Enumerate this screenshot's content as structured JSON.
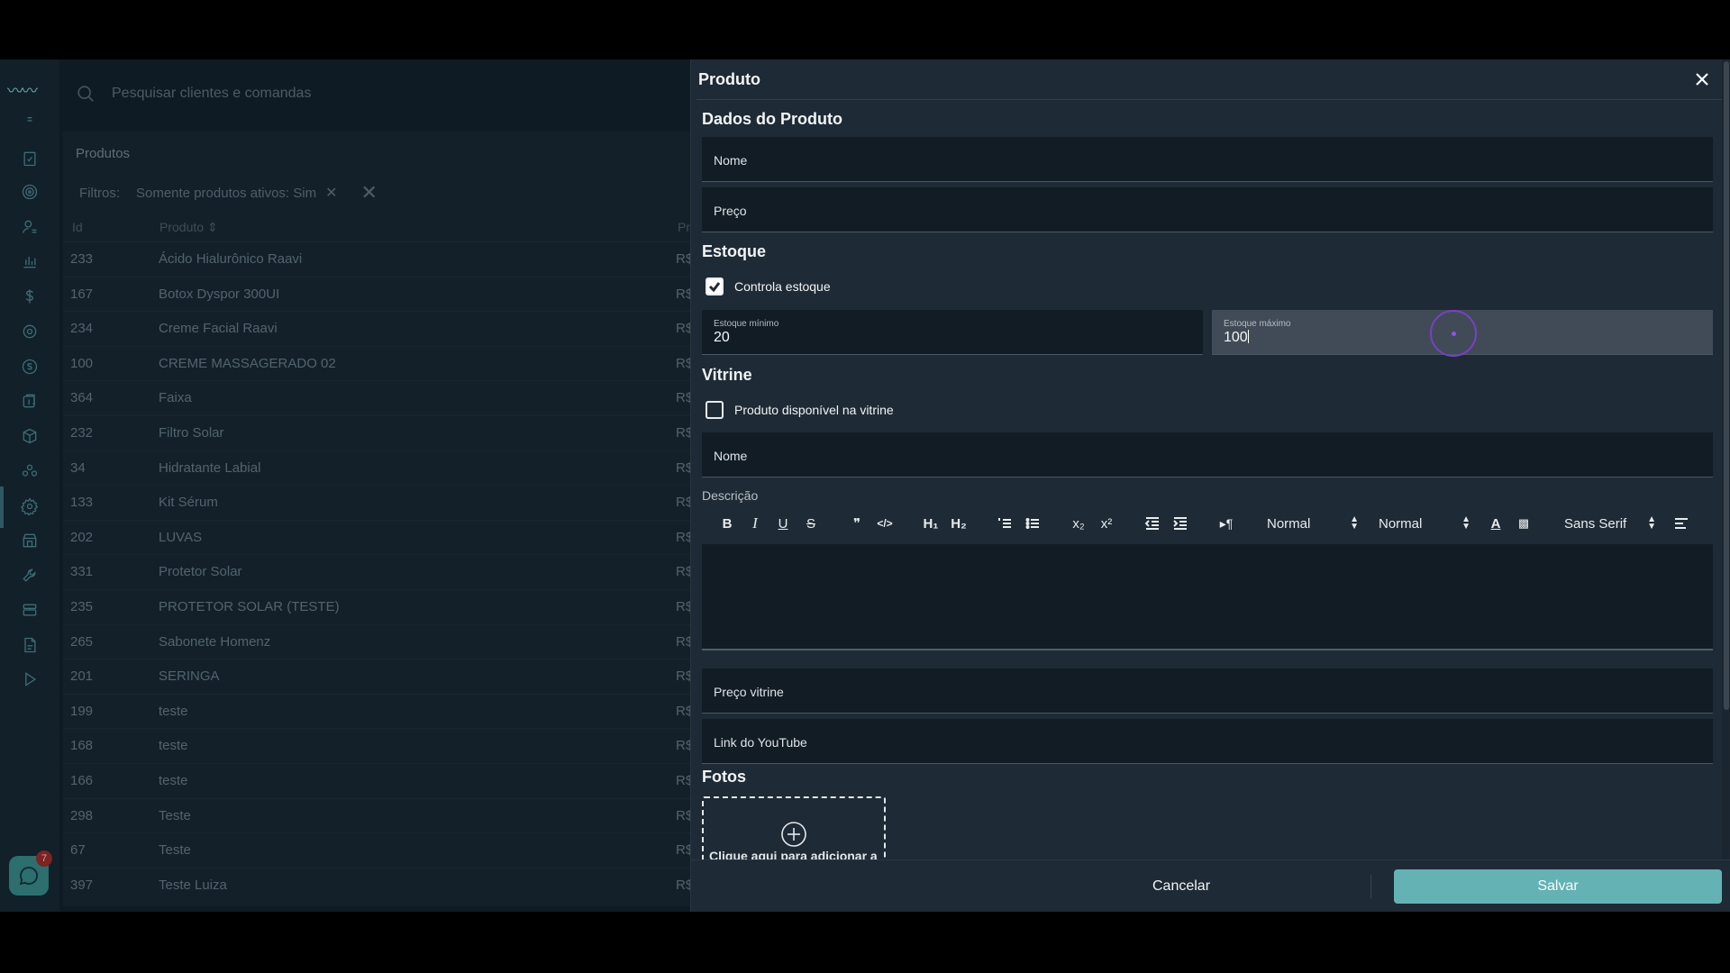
{
  "search": {
    "placeholder": "Pesquisar clientes e comandas"
  },
  "list": {
    "title": "Produtos",
    "filters_label": "Filtros:",
    "filter_chip": "Somente produtos ativos: Sim",
    "columns": {
      "id": "Id",
      "product": "Produto",
      "price": "Pr"
    },
    "currency": "R$",
    "rows": [
      {
        "id": "233",
        "name": "Ácido Hialurônico Raavi"
      },
      {
        "id": "167",
        "name": "Botox Dyspor 300UI"
      },
      {
        "id": "234",
        "name": "Creme Facial Raavi"
      },
      {
        "id": "100",
        "name": "CREME MASSAGERADO 02"
      },
      {
        "id": "364",
        "name": "Faixa"
      },
      {
        "id": "232",
        "name": "Filtro Solar"
      },
      {
        "id": "34",
        "name": "Hidratante Labial"
      },
      {
        "id": "133",
        "name": "Kit Sérum"
      },
      {
        "id": "202",
        "name": "LUVAS"
      },
      {
        "id": "331",
        "name": "Protetor Solar"
      },
      {
        "id": "235",
        "name": "PROTETOR SOLAR (TESTE)"
      },
      {
        "id": "265",
        "name": "Sabonete Homenz"
      },
      {
        "id": "201",
        "name": "SERINGA"
      },
      {
        "id": "199",
        "name": "teste"
      },
      {
        "id": "168",
        "name": "teste"
      },
      {
        "id": "166",
        "name": "teste"
      },
      {
        "id": "298",
        "name": "Teste"
      },
      {
        "id": "67",
        "name": "Teste"
      },
      {
        "id": "397",
        "name": "Teste Luiza"
      }
    ]
  },
  "rail": {
    "icons": [
      "menu-icon",
      "clipboard-icon",
      "target-icon",
      "user-icon",
      "chart-icon",
      "dollar-icon",
      "settings-cog-icon",
      "coin-icon",
      "box-dollar-icon",
      "package-icon",
      "group-icon",
      "gear-icon",
      "store-icon",
      "wrench-icon",
      "layers-icon",
      "document-icon",
      "play-icon"
    ],
    "chat_badge": "7"
  },
  "drawer": {
    "title": "Produto",
    "section_product": "Dados do Produto",
    "name_label": "Nome",
    "price_label": "Preço",
    "section_stock": "Estoque",
    "controls_stock_label": "Controla estoque",
    "controls_stock_checked": true,
    "min_stock": {
      "label": "Estoque mínimo",
      "value": "20"
    },
    "max_stock": {
      "label": "Estoque máximo",
      "value": "100"
    },
    "section_showcase": "Vitrine",
    "showcase_label": "Produto disponível na vitrine",
    "showcase_checked": false,
    "showcase_name_label": "Nome",
    "description_label": "Descrição",
    "toolbar": {
      "bold": "B",
      "italic": "I",
      "underline": "U",
      "strike": "S",
      "quote": "❞",
      "code": "</>",
      "h1": "H₁",
      "h2": "H₂",
      "sub": "x₂",
      "sup": "x²",
      "header_select": "Normal",
      "size_select": "Normal",
      "font_select": "Sans Serif"
    },
    "showcase_price_label": "Preço vitrine",
    "youtube_label": "Link do YouTube",
    "section_photos": "Fotos",
    "upload_text": "Clique aqui para adicionar a",
    "cancel_label": "Cancelar",
    "save_label": "Salvar"
  },
  "colors": {
    "accent": "#64b2b4",
    "focus_ring": "#7a3fc8",
    "drawer_bg": "#1e2a35",
    "field_bg": "#111c25"
  }
}
